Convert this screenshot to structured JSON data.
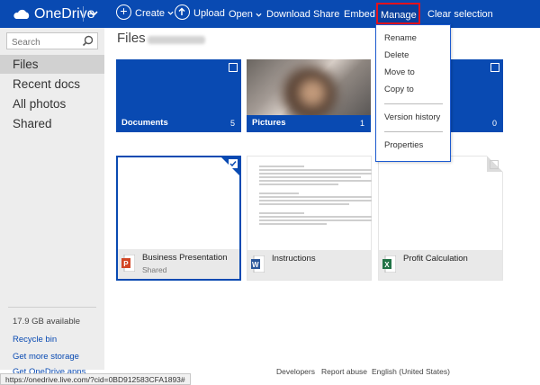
{
  "app": {
    "name": "OneDrive"
  },
  "toolbar": {
    "create": "Create",
    "upload": "Upload",
    "open": "Open",
    "download": "Download",
    "share": "Share",
    "embed": "Embed",
    "manage": "Manage",
    "clear_selection": "Clear selection"
  },
  "sidebar": {
    "search_placeholder": "Search",
    "items": [
      {
        "label": "Files"
      },
      {
        "label": "Recent docs"
      },
      {
        "label": "All photos"
      },
      {
        "label": "Shared"
      }
    ],
    "storage": "17.9 GB available",
    "recycle_bin": "Recycle bin",
    "get_more_storage": "Get more storage",
    "get_apps": "Get OneDrive apps"
  },
  "main": {
    "title": "Files",
    "folders": [
      {
        "name": "Documents",
        "count": "5"
      },
      {
        "name": "Pictures",
        "count": "1"
      },
      {
        "name": "",
        "count": "0"
      }
    ],
    "documents": [
      {
        "name": "Business Presentation",
        "sub": "Shared",
        "icon": "powerpoint-icon"
      },
      {
        "name": "Instructions",
        "sub": "",
        "icon": "word-icon"
      },
      {
        "name": "Profit Calculation",
        "sub": "",
        "icon": "excel-icon"
      }
    ]
  },
  "manage_menu": {
    "items": [
      "Rename",
      "Delete",
      "Move to",
      "Copy to",
      "Version history",
      "Properties"
    ]
  },
  "footer": {
    "links": [
      "Developers",
      "Report abuse",
      "English (United States)"
    ]
  },
  "status_bar": {
    "url": "https://onedrive.live.com/?cid=0BD912583CFA1893#"
  },
  "colors": {
    "brand_blue": "#094ab2",
    "highlight_red": "#e3121d",
    "word": "#2b579a",
    "excel": "#217346",
    "powerpoint": "#d24726"
  }
}
